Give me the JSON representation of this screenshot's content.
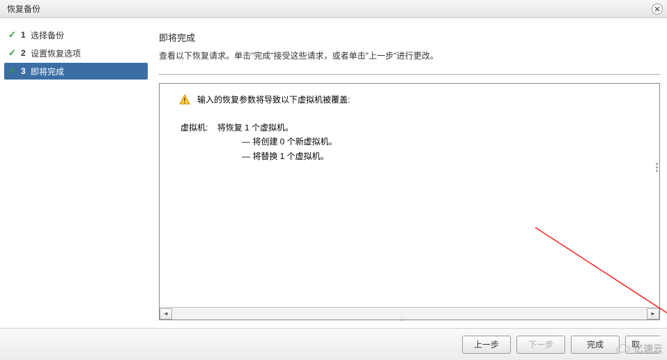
{
  "window": {
    "title": "恢复备份"
  },
  "steps": [
    {
      "num": "1",
      "label": "选择备份",
      "done": true,
      "current": false
    },
    {
      "num": "2",
      "label": "设置恢复选项",
      "done": true,
      "current": false
    },
    {
      "num": "3",
      "label": "即将完成",
      "done": true,
      "current": true
    }
  ],
  "main": {
    "heading": "即将完成",
    "subtext": "查看以下恢复请求。单击\"完成\"接受这些请求，或者单击\"上一步\"进行更改。",
    "warning": "输入的恢复参数将导致以下虚拟机被覆盖:",
    "vm_label": "虚拟机:",
    "vm_summary": "将恢复 1 个虚拟机。",
    "vm_line1": "— 将创建 0 个新虚拟机。",
    "vm_line2": "— 将替换 1 个虚拟机。"
  },
  "buttons": {
    "back": "上一步",
    "next": "下一步",
    "finish": "完成",
    "cancel": "取"
  },
  "watermark": "亿速云"
}
